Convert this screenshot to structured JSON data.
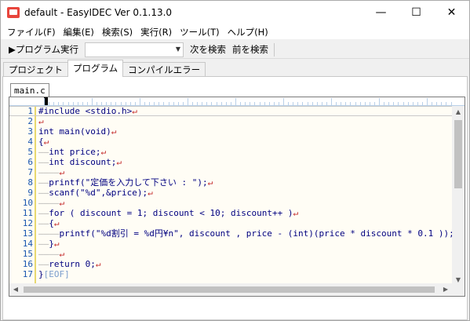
{
  "window": {
    "title": "default - EasyIDEC Ver 0.1.13.0"
  },
  "titlebar": {
    "minimize": "—",
    "maximize": "☐",
    "close": "✕"
  },
  "menu": [
    "ファイル(F)",
    "編集(E)",
    "検索(S)",
    "実行(R)",
    "ツール(T)",
    "ヘルプ(H)"
  ],
  "toolbar": {
    "run_label": "▶プログラム実行",
    "search_value": "",
    "next_label": "次を検索",
    "prev_label": "前を検索"
  },
  "tabs": [
    {
      "label": "プロジェクト",
      "active": false
    },
    {
      "label": "プログラム",
      "active": true
    },
    {
      "label": "コンパイルエラー",
      "active": false
    }
  ],
  "file_tab": "main.c",
  "code_lines": [
    {
      "no": "1",
      "text": "#include <stdio.h>↵"
    },
    {
      "no": "2",
      "text": "↵"
    },
    {
      "no": "3",
      "text": "int main(void)↵"
    },
    {
      "no": "4",
      "text": "{↵"
    },
    {
      "no": "5",
      "text": "——int price;↵"
    },
    {
      "no": "6",
      "text": "——int discount;↵"
    },
    {
      "no": "7",
      "text": "————↵"
    },
    {
      "no": "8",
      "text": "——printf(\"定価を入力して下さい : \");↵"
    },
    {
      "no": "9",
      "text": "——scanf(\"%d\",&price);↵"
    },
    {
      "no": "10",
      "text": "————↵"
    },
    {
      "no": "11",
      "text": "——for ( discount = 1; discount < 10; discount++ )↵"
    },
    {
      "no": "12",
      "text": "——{↵"
    },
    {
      "no": "13",
      "text": "————printf(\"%d割引 = %d円¥n\", discount , price - (int)(price * discount * 0.1 ));↵"
    },
    {
      "no": "14",
      "text": "——}↵"
    },
    {
      "no": "15",
      "text": "————↵"
    },
    {
      "no": "16",
      "text": "——return 0;↵"
    },
    {
      "no": "17",
      "text": "}[EOF]"
    }
  ],
  "icons": {
    "app": "easyidec-app-icon",
    "scroll_up": "▲",
    "scroll_down": "▼",
    "scroll_left": "◀",
    "scroll_right": "▶",
    "combo_arrow": "▼"
  },
  "colors": {
    "editor_bg": "#fffdf5",
    "line_numbers": "#1a56b0",
    "code_text": "#000080",
    "newline_mark": "#c42b2b",
    "fold_bar": "#e8d870"
  }
}
